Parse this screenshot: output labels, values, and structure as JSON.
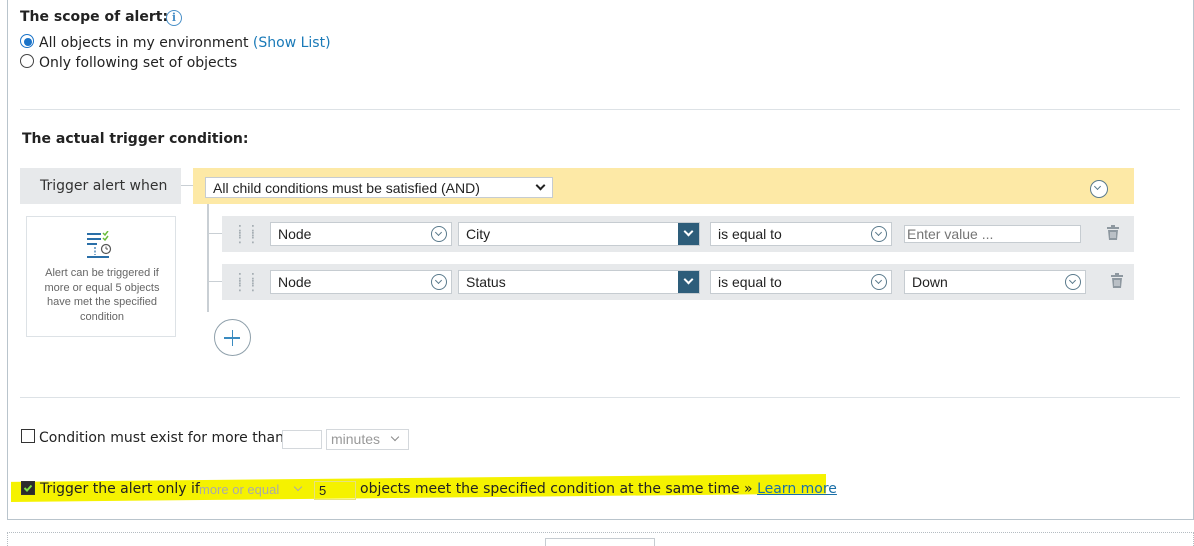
{
  "scope": {
    "title": "The scope of alert:",
    "info_icon": "info-icon",
    "option_all": "All objects in my environment",
    "show_list": "(Show List)",
    "option_following": "Only following set of objects",
    "selected": "all"
  },
  "trigger": {
    "title": "The actual trigger condition:",
    "when_label": "Trigger alert when",
    "group_select": "All child conditions must be satisfied (AND)",
    "info_box": "Alert can be triggered if more or equal 5 objects have met the specified condition",
    "conditions": [
      {
        "entity": "Node",
        "field": "City",
        "operator": "is equal to",
        "value": "",
        "value_placeholder": "Enter value ..."
      },
      {
        "entity": "Node",
        "field": "Status",
        "operator": "is equal to",
        "value": "Down"
      }
    ]
  },
  "duration": {
    "checked": false,
    "label": "Condition must exist for more than",
    "value": "",
    "unit": "minutes"
  },
  "count": {
    "checked": true,
    "label": "Trigger the alert only if",
    "comparator": "more or equal",
    "value": "5",
    "suffix": "objects meet the specified condition at the same time »",
    "learn_more": "Learn more",
    "highlight_color": "#f5f200"
  },
  "colors": {
    "accent_blue": "#1a7ab8",
    "group_header": "#fde9a6",
    "row_bg": "#e7e9eb",
    "dark_button": "#2d5d7a"
  }
}
